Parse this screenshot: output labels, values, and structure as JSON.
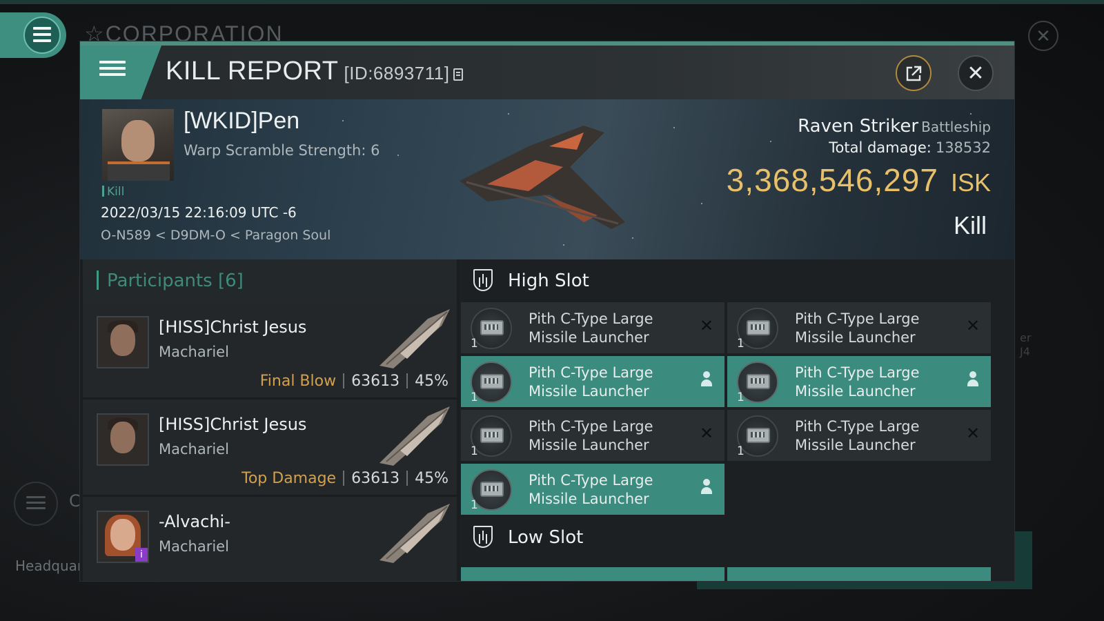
{
  "background": {
    "corporation_label": "CORPORATION",
    "headquarters_label": "Headquar",
    "side_letter": "C",
    "right_text_1": "er",
    "right_text_2": "J4"
  },
  "header": {
    "title": "KILL REPORT",
    "report_id": "[ID:6893711]"
  },
  "victim": {
    "name": "[WKID]Pen",
    "warp_scramble": "Warp Scramble Strength: 6",
    "kill_tag": "Kill",
    "datetime": "2022/03/15 22:16:09 UTC -6",
    "location": "O-N589 < D9DM-O < Paragon Soul",
    "ship_name": "Raven Striker",
    "ship_class": "Battleship",
    "total_damage_label": "Total damage:",
    "total_damage_value": "138532",
    "isk_value": "3,368,546,297",
    "isk_unit": "ISK",
    "result": "Kill"
  },
  "participants": {
    "title": "Participants [6]",
    "rows": [
      {
        "name": "[HISS]Christ Jesus",
        "ship": "Machariel",
        "role": "Final Blow",
        "damage": "63613",
        "percent": "45%"
      },
      {
        "name": "[HISS]Christ Jesus",
        "ship": "Machariel",
        "role": "Top Damage",
        "damage": "63613",
        "percent": "45%"
      },
      {
        "name": "-Alvachi-",
        "ship": "Machariel",
        "role": "",
        "damage": "",
        "percent": ""
      }
    ]
  },
  "fitting": {
    "high_slot_title": "High Slot",
    "low_slot_title": "Low Slot",
    "modules": [
      {
        "name": "Pith C-Type Large Missile Launcher",
        "qty": "1",
        "status": "destroyed"
      },
      {
        "name": "Pith C-Type Large Missile Launcher",
        "qty": "1",
        "status": "destroyed"
      },
      {
        "name": "Pith C-Type Large Missile Launcher",
        "qty": "1",
        "status": "dropped"
      },
      {
        "name": "Pith C-Type Large Missile Launcher",
        "qty": "1",
        "status": "dropped"
      },
      {
        "name": "Pith C-Type Large Missile Launcher",
        "qty": "1",
        "status": "destroyed"
      },
      {
        "name": "Pith C-Type Large Missile Launcher",
        "qty": "1",
        "status": "destroyed"
      },
      {
        "name": "Pith C-Type Large Missile Launcher",
        "qty": "1",
        "status": "dropped"
      }
    ]
  },
  "colors": {
    "accent": "#3f8f80",
    "isk": "#e9c06a",
    "role": "#d3a04d"
  }
}
